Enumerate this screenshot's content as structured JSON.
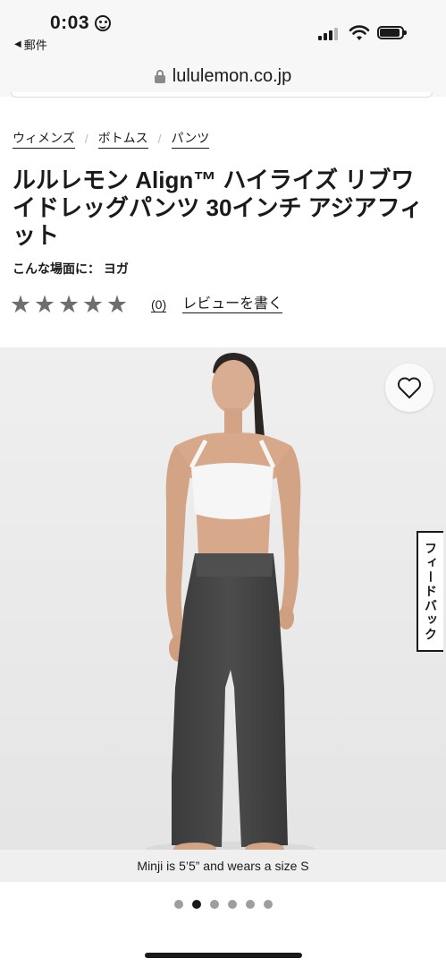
{
  "status_bar": {
    "time": "0:03",
    "back_app": "郵件"
  },
  "browser": {
    "url": "lululemon.co.jp"
  },
  "breadcrumb": [
    {
      "label": "ウィメンズ"
    },
    {
      "label": "ボトムス"
    },
    {
      "label": "パンツ"
    }
  ],
  "product": {
    "title": "ルルレモン Align™ ハイライズ リブワイドレッグパンツ 30インチ アジアフィット",
    "activity": "こんな場面に： ヨガ",
    "rating": 5,
    "review_count": "(0)",
    "write_review": "レビューを書く"
  },
  "gallery": {
    "caption": "Minji is 5’5” and wears a size S",
    "feedback_label": "フィードバック",
    "total_images": 6,
    "active_index": 1
  },
  "colors": {
    "background": "#ebebeb",
    "text": "#1a1a1a",
    "star": "#6e6e6e",
    "pants": "#454545"
  }
}
